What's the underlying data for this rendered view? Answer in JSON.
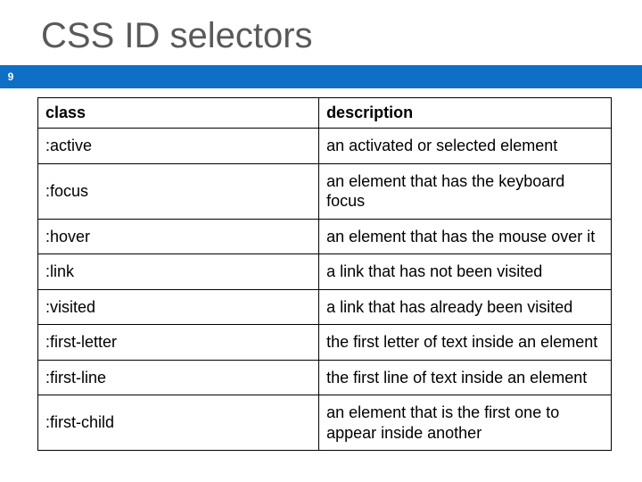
{
  "slide": {
    "number": "9",
    "title": "CSS ID selectors"
  },
  "table": {
    "headers": {
      "class": "class",
      "description": "description"
    },
    "rows": [
      {
        "class": ":active",
        "description": "an activated or selected element"
      },
      {
        "class": ":focus",
        "description": "an element that has the keyboard focus"
      },
      {
        "class": ":hover",
        "description": "an element that has the mouse over it"
      },
      {
        "class": ":link",
        "description": "a link that has not been visited"
      },
      {
        "class": ":visited",
        "description": "a link that has already been visited"
      },
      {
        "class": ":first-letter",
        "description": "the first letter of text inside an element"
      },
      {
        "class": ":first-line",
        "description": "the first line of text inside an element"
      },
      {
        "class": ":first-child",
        "description": "an element that is the first one to appear inside another"
      }
    ]
  }
}
